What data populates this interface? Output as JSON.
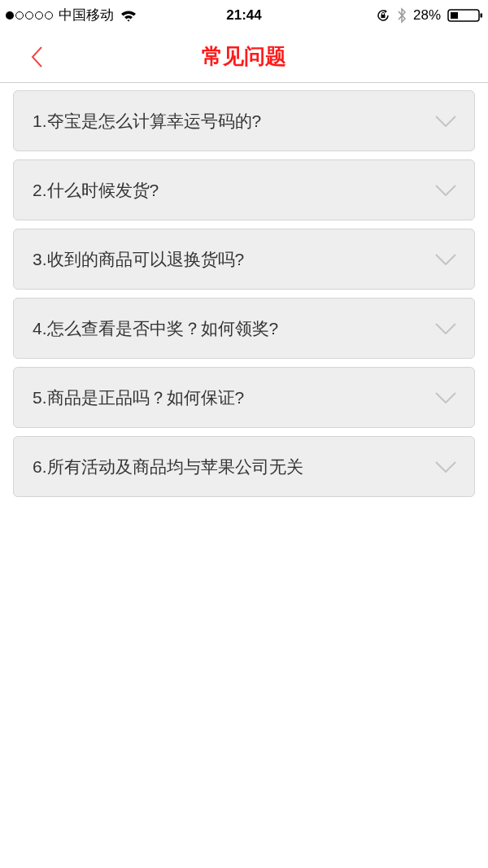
{
  "status_bar": {
    "carrier": "中国移动",
    "time": "21:44",
    "battery": "28%"
  },
  "nav": {
    "title": "常见问题"
  },
  "faq": [
    {
      "question": "1.夺宝是怎么计算幸运号码的?",
      "expanded": false
    },
    {
      "question": "2.什么时候发货?",
      "expanded": false
    },
    {
      "question": "3.收到的商品可以退换货吗?",
      "expanded": false
    },
    {
      "question": "4.怎么查看是否中奖？如何领奖?",
      "expanded": false
    },
    {
      "question": "5.商品是正品吗？如何保证?",
      "expanded": false
    },
    {
      "question": "6.所有活动及商品均与苹果公司无关",
      "expanded": false
    }
  ]
}
